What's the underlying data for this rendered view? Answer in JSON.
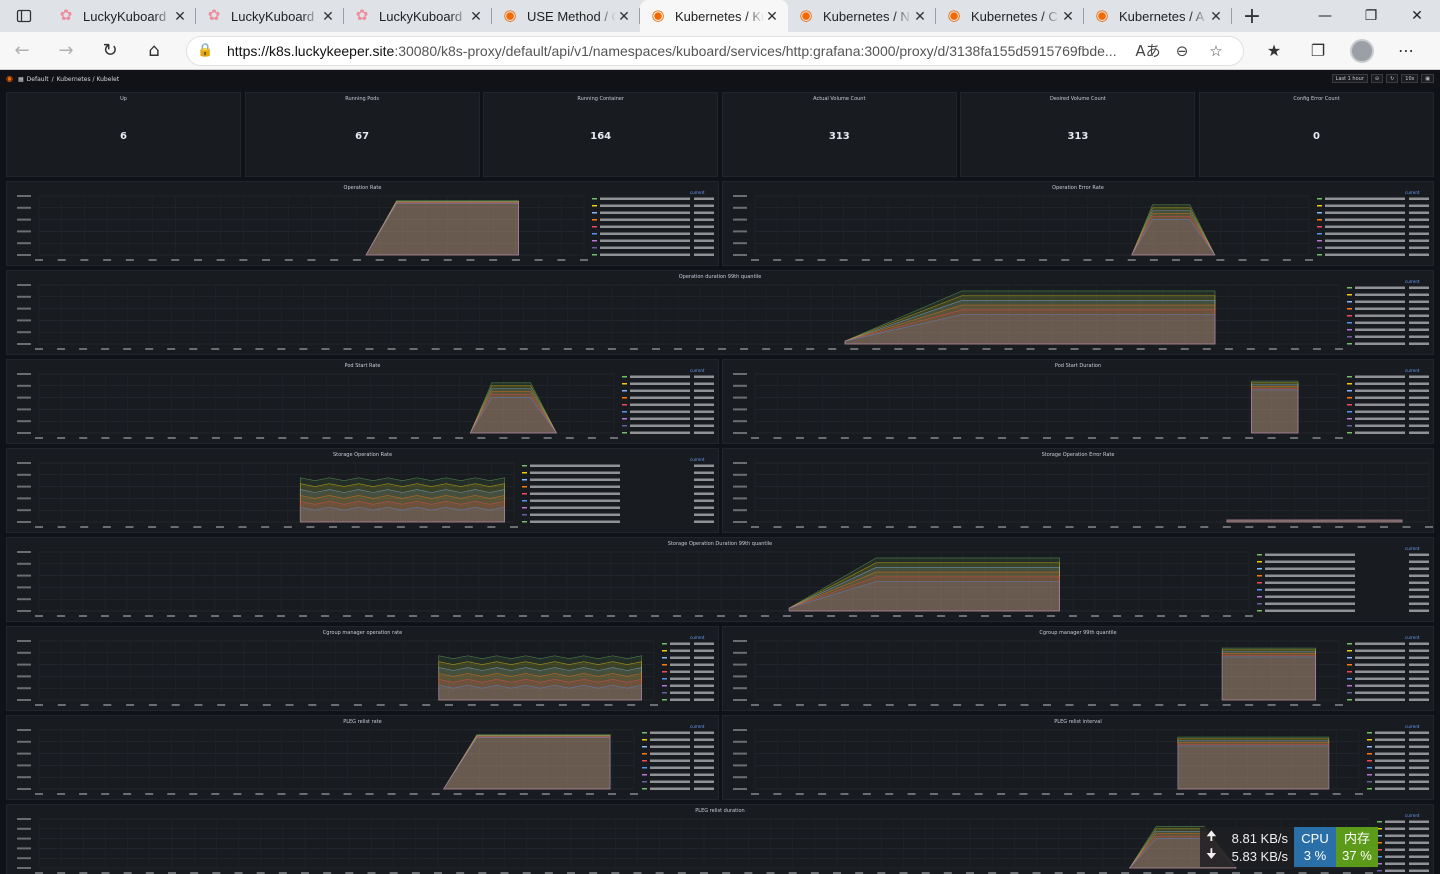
{
  "browser": {
    "tabs": [
      {
        "title": "LuckyKuboard",
        "icon": "flower-icon",
        "active": false
      },
      {
        "title": "LuckyKuboard",
        "icon": "flower-icon",
        "active": false
      },
      {
        "title": "LuckyKuboard",
        "icon": "flower-icon",
        "active": false
      },
      {
        "title": "USE Method / C",
        "icon": "grafana-icon",
        "active": false
      },
      {
        "title": "Kubernetes / Ku",
        "icon": "grafana-icon",
        "active": true
      },
      {
        "title": "Kubernetes / N",
        "icon": "grafana-icon",
        "active": false
      },
      {
        "title": "Kubernetes / C",
        "icon": "grafana-icon",
        "active": false
      },
      {
        "title": "Kubernetes / A",
        "icon": "grafana-icon",
        "active": false
      }
    ],
    "url_host": "https://k8s.luckykeeper.site",
    "url_rest": ":30080/k8s-proxy/default/api/v1/namespaces/kuboard/services/http:grafana:3000/proxy/d/3138fa155d5915769fbde..."
  },
  "grafana": {
    "breadcrumb": [
      "Default",
      "/",
      "Kubernetes / Kubelet"
    ],
    "time_picker": "Last 1 hour",
    "refresh": "10s",
    "stats": [
      {
        "title": "Up",
        "value": "6"
      },
      {
        "title": "Running Pods",
        "value": "67"
      },
      {
        "title": "Running Container",
        "value": "164"
      },
      {
        "title": "Actual Volume Count",
        "value": "313"
      },
      {
        "title": "Desired Volume Count",
        "value": "313"
      },
      {
        "title": "Config Error Count",
        "value": "0"
      }
    ],
    "panels": {
      "op_rate": {
        "title": "Operation Rate"
      },
      "op_error_rate": {
        "title": "Operation Error Rate"
      },
      "op_duration": {
        "title": "Operation duration 99th quantile"
      },
      "pod_start_rate": {
        "title": "Pod Start Rate"
      },
      "pod_start_duration": {
        "title": "Pod Start Duration"
      },
      "storage_op_rate": {
        "title": "Storage Operation Rate"
      },
      "storage_op_error_rate": {
        "title": "Storage Operation Error Rate"
      },
      "storage_op_duration": {
        "title": "Storage Operation Duration 99th quantile"
      },
      "cgroup_rate": {
        "title": "Cgroup manager operation rate"
      },
      "cgroup_quantile": {
        "title": "Cgroup manager 99th quantile"
      },
      "pleg_rate": {
        "title": "PLEG relist rate"
      },
      "pleg_interval": {
        "title": "PLEG relist interval"
      },
      "pleg_duration": {
        "title": "PLEG relist duration"
      }
    },
    "legend_title": "current"
  },
  "tray": {
    "upload": "8.81 KB/s",
    "download": "5.83 KB/s",
    "cpu_label": "CPU",
    "cpu_value": "3 %",
    "mem_label": "内存",
    "mem_value": "37 %"
  },
  "colors": {
    "series": [
      "#73bf69",
      "#f2cc0c",
      "#8ab8ff",
      "#ff780a",
      "#f2495c",
      "#5794f2",
      "#b877d9",
      "#705da0"
    ]
  }
}
